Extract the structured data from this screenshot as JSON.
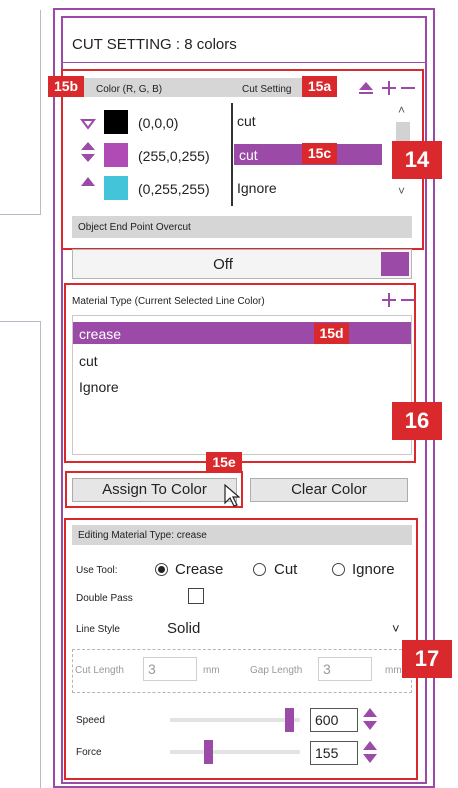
{
  "panel": {
    "title": "CUT SETTING : 8 colors",
    "color_header": "Color (R, G, B)",
    "cut_header": "Cut Setting",
    "rows": [
      {
        "swatch": "#000000",
        "rgb": "(0,0,0)",
        "setting": "cut"
      },
      {
        "swatch": "#b04bb6",
        "rgb": "(255,0,255)",
        "setting": "cut"
      },
      {
        "swatch": "#44c4d8",
        "rgb": "(0,255,255)",
        "setting": "Ignore"
      }
    ],
    "overcut_label": "Object End Point Overcut",
    "overcut_value": "Off"
  },
  "material": {
    "header": "Material Type (Current Selected Line Color)",
    "items": [
      "crease",
      "cut",
      "Ignore"
    ],
    "selected": "crease"
  },
  "buttons": {
    "assign": "Assign To Color",
    "clear": "Clear Color"
  },
  "editing": {
    "header": "Editing Material Type: crease",
    "use_tool_label": "Use Tool:",
    "tool_options": [
      "Crease",
      "Cut",
      "Ignore"
    ],
    "selected_tool": "Crease",
    "double_pass_label": "Double Pass",
    "line_style_label": "Line Style",
    "line_style_value": "Solid",
    "cut_length_label": "Cut Length",
    "cut_length_value": "3",
    "gap_length_label": "Gap Length",
    "gap_length_value": "3",
    "mm": "mm",
    "speed_label": "Speed",
    "speed_value": "600",
    "speed_fraction": 0.95,
    "force_label": "Force",
    "force_value": "155",
    "force_fraction": 0.28
  },
  "callouts": {
    "c15b": "15b",
    "c15a": "15a",
    "c15c": "15c",
    "c15d": "15d",
    "c15e": "15e",
    "c14": "14",
    "c16": "16",
    "c17": "17"
  },
  "colors": {
    "accent": "#9b4aa8",
    "callout": "#d9292c",
    "selected_row": "#9b4aa8"
  }
}
